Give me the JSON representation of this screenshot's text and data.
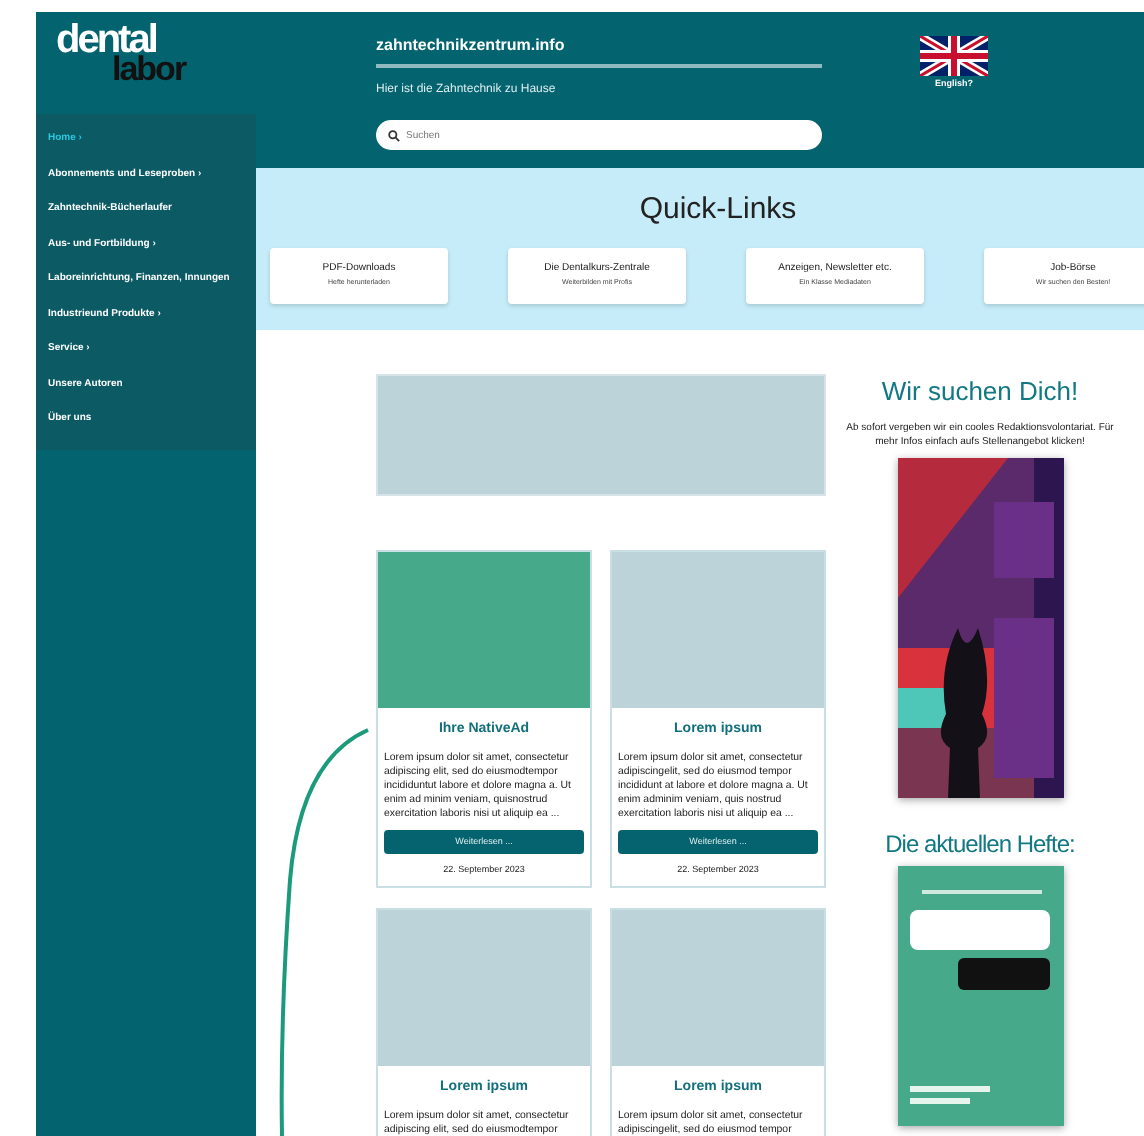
{
  "logo": {
    "line_1": "dental",
    "line_2": "labor"
  },
  "sidebar": {
    "items": [
      {
        "label": "Home",
        "has_submenu": true,
        "selected": true
      },
      {
        "label": "Abonnements und Leseproben",
        "has_submenu": true,
        "selected": false
      },
      {
        "label": "Zahntechnik-Bücherlaufer",
        "has_submenu": false,
        "selected": false
      },
      {
        "label": "Aus- und Fortbildung",
        "has_submenu": true,
        "selected": false
      },
      {
        "label": "Laboreinrichtung, Finanzen, Innungen",
        "has_submenu": false,
        "selected": false
      },
      {
        "label": "Industrieund Produkte",
        "has_submenu": true,
        "selected": false
      },
      {
        "label": "Service",
        "has_submenu": true,
        "selected": false
      },
      {
        "label": "Unsere Autoren",
        "has_submenu": false,
        "selected": false
      },
      {
        "label": "Über uns",
        "has_submenu": false,
        "selected": false
      }
    ],
    "submenu_marker": "›"
  },
  "header": {
    "site": "zahntechnikzentrum.info",
    "tagline": "Hier ist die Zahntechnik zu Hause",
    "search": {
      "placeholder": "Suchen"
    },
    "language": "English?"
  },
  "quick_links": {
    "title": "Quick-Links",
    "items": [
      {
        "title": "PDF-Downloads",
        "subtitle": "Hefte herunterladen"
      },
      {
        "title": "Die Dentalkurs-Zentrale",
        "subtitle": "Weiterbilden mit Profis"
      },
      {
        "title": "Anzeigen, Newsletter etc.",
        "subtitle": "Ein Klasse Mediadaten"
      },
      {
        "title": "Job-Börse",
        "subtitle": "Wir suchen den Besten!"
      }
    ]
  },
  "articles": [
    {
      "kind": "ad",
      "title": "Ihre NativeAd",
      "text": "Lorem ipsum dolor sit amet, consectetur adipiscing elit, sed do eiusmodtempor incididuntut labore et dolore magna a. Ut enim ad minim veniam, quisnostrud exercitation laboris nisi ut aliquip ea ...",
      "button": "Weiterlesen ...",
      "date": "22. September 2023"
    },
    {
      "kind": "article",
      "title": "Lorem ipsum",
      "text": "Lorem ipsum dolor sit amet, consectetur adipiscingelit, sed do eiusmod tempor incididunt at labore et dolore magna a. Ut enim adminim veniam, quis nostrud exercitation laboris nisi ut aliquip ea ...",
      "button": "Weiterlesen ...",
      "date": "22. September 2023"
    },
    {
      "kind": "article",
      "title": "Lorem ipsum",
      "text": "Lorem ipsum dolor sit amet, consectetur adipiscing elit, sed do eiusmodtempor"
    },
    {
      "kind": "article",
      "title": "Lorem ipsum",
      "text": "Lorem ipsum dolor sit amet, consectetur adipiscingelit, sed do eiusmod tempor"
    }
  ],
  "aside": {
    "job_title": "Wir suchen Dich!",
    "job_text": "Ab sofort vergeben wir ein cooles Redaktionsvolontariat. Für mehr Infos einfach aufs Stellenangebot klicken!",
    "issues_title": "Die aktuellen Hefte:"
  }
}
